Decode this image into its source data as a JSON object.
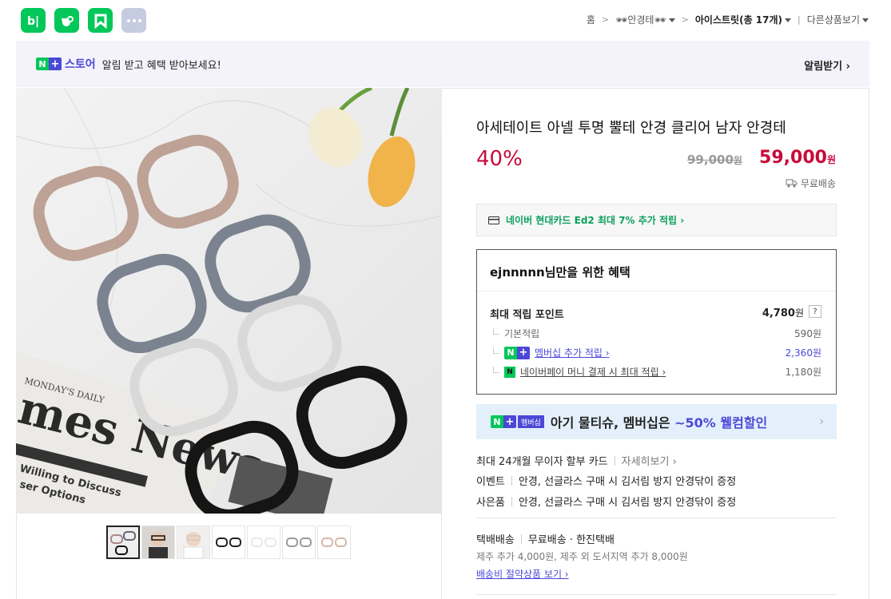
{
  "apps": [
    {
      "name": "blog",
      "glyph": "b|",
      "color": "#03c75a"
    },
    {
      "name": "cafe",
      "glyph": "☕",
      "color": "#03c75a"
    },
    {
      "name": "bookmark",
      "glyph": "K",
      "color": "#03c75a"
    },
    {
      "name": "more",
      "glyph": "•••",
      "color": "#c5cbe0"
    }
  ],
  "breadcrumb": {
    "home": "홈",
    "category": "🕶안경테🕶",
    "store": "아이스트릿(총 17개)",
    "other": "다른상품보기"
  },
  "banner": {
    "badge_n": "N",
    "badge_plus": "+",
    "store": "스토어",
    "message": "알림 받고 혜택 받아보세요!",
    "action": "알림받기 ›"
  },
  "product": {
    "title": "아세테이트 아넬 투명 뿔테 안경 클리어 남자 안경테",
    "discount": "40%",
    "original_price": "99,000",
    "original_unit": "원",
    "sale_price": "59,000",
    "sale_unit": "원",
    "shipping": "무료배송"
  },
  "card_offer": "네이버 현대카드 Ed2 최대 7% 추가 적립 ›",
  "benefit": {
    "title": "ejnnnnn님만을 위한 혜택",
    "max_label": "최대 적립 포인트",
    "max_value": "4,780",
    "max_unit": "원",
    "help": "?",
    "rows": [
      {
        "label": "기본적립",
        "value": "590원"
      },
      {
        "label": "멤버십 추가 적립 ›",
        "value": "2,360원"
      },
      {
        "label": "네이버페이 머니 결제 시 최대 적립 ›",
        "value": "1,180원"
      }
    ]
  },
  "promo": {
    "badge": "멤버십",
    "text_a": "아기 물티슈, 멤버십은 ",
    "text_b": "~50% 웰컴할인",
    "arrow": "›"
  },
  "details": {
    "installment": "최대 24개월 무이자 할부 카드",
    "installment_link": "자세히보기 ›",
    "event_label": "이벤트",
    "event_text": "안경, 선글라스 구매 시 김서림 방지 안경닦이 증정",
    "gift_label": "사은품",
    "gift_text": "안경, 선글라스 구매 시 김서림 방지 안경닦이 증정"
  },
  "delivery": {
    "label": "택배배송",
    "method": "무료배송 · 한진택배",
    "extra": "제주 추가 4,000원, 제주 외 도서지역 추가 8,000원",
    "link": "배송비 절약상품 보기 ›"
  },
  "image_overlay": {
    "paper_top": "MONDAY'S DAILY",
    "paper_big": "mes News",
    "paper_sub1": "Willing to Discuss",
    "paper_sub2": "ser Options"
  }
}
